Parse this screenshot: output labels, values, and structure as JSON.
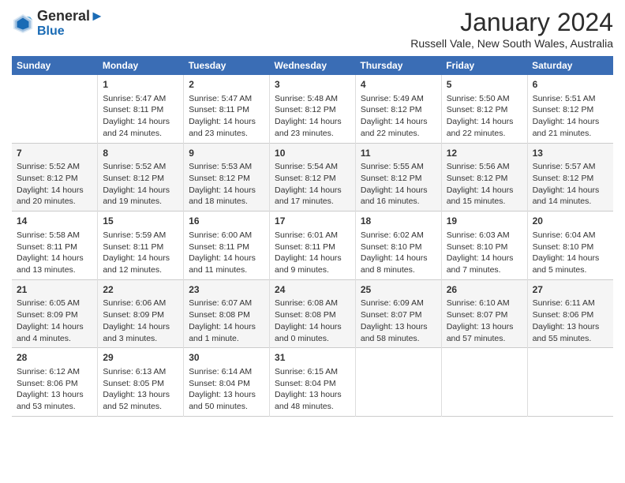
{
  "header": {
    "logo_line1": "General",
    "logo_line2": "Blue",
    "month_year": "January 2024",
    "location": "Russell Vale, New South Wales, Australia"
  },
  "weekdays": [
    "Sunday",
    "Monday",
    "Tuesday",
    "Wednesday",
    "Thursday",
    "Friday",
    "Saturday"
  ],
  "weeks": [
    [
      {
        "day": "",
        "info": ""
      },
      {
        "day": "1",
        "info": "Sunrise: 5:47 AM\nSunset: 8:11 PM\nDaylight: 14 hours\nand 24 minutes."
      },
      {
        "day": "2",
        "info": "Sunrise: 5:47 AM\nSunset: 8:11 PM\nDaylight: 14 hours\nand 23 minutes."
      },
      {
        "day": "3",
        "info": "Sunrise: 5:48 AM\nSunset: 8:12 PM\nDaylight: 14 hours\nand 23 minutes."
      },
      {
        "day": "4",
        "info": "Sunrise: 5:49 AM\nSunset: 8:12 PM\nDaylight: 14 hours\nand 22 minutes."
      },
      {
        "day": "5",
        "info": "Sunrise: 5:50 AM\nSunset: 8:12 PM\nDaylight: 14 hours\nand 22 minutes."
      },
      {
        "day": "6",
        "info": "Sunrise: 5:51 AM\nSunset: 8:12 PM\nDaylight: 14 hours\nand 21 minutes."
      }
    ],
    [
      {
        "day": "7",
        "info": "Sunrise: 5:52 AM\nSunset: 8:12 PM\nDaylight: 14 hours\nand 20 minutes."
      },
      {
        "day": "8",
        "info": "Sunrise: 5:52 AM\nSunset: 8:12 PM\nDaylight: 14 hours\nand 19 minutes."
      },
      {
        "day": "9",
        "info": "Sunrise: 5:53 AM\nSunset: 8:12 PM\nDaylight: 14 hours\nand 18 minutes."
      },
      {
        "day": "10",
        "info": "Sunrise: 5:54 AM\nSunset: 8:12 PM\nDaylight: 14 hours\nand 17 minutes."
      },
      {
        "day": "11",
        "info": "Sunrise: 5:55 AM\nSunset: 8:12 PM\nDaylight: 14 hours\nand 16 minutes."
      },
      {
        "day": "12",
        "info": "Sunrise: 5:56 AM\nSunset: 8:12 PM\nDaylight: 14 hours\nand 15 minutes."
      },
      {
        "day": "13",
        "info": "Sunrise: 5:57 AM\nSunset: 8:12 PM\nDaylight: 14 hours\nand 14 minutes."
      }
    ],
    [
      {
        "day": "14",
        "info": "Sunrise: 5:58 AM\nSunset: 8:11 PM\nDaylight: 14 hours\nand 13 minutes."
      },
      {
        "day": "15",
        "info": "Sunrise: 5:59 AM\nSunset: 8:11 PM\nDaylight: 14 hours\nand 12 minutes."
      },
      {
        "day": "16",
        "info": "Sunrise: 6:00 AM\nSunset: 8:11 PM\nDaylight: 14 hours\nand 11 minutes."
      },
      {
        "day": "17",
        "info": "Sunrise: 6:01 AM\nSunset: 8:11 PM\nDaylight: 14 hours\nand 9 minutes."
      },
      {
        "day": "18",
        "info": "Sunrise: 6:02 AM\nSunset: 8:10 PM\nDaylight: 14 hours\nand 8 minutes."
      },
      {
        "day": "19",
        "info": "Sunrise: 6:03 AM\nSunset: 8:10 PM\nDaylight: 14 hours\nand 7 minutes."
      },
      {
        "day": "20",
        "info": "Sunrise: 6:04 AM\nSunset: 8:10 PM\nDaylight: 14 hours\nand 5 minutes."
      }
    ],
    [
      {
        "day": "21",
        "info": "Sunrise: 6:05 AM\nSunset: 8:09 PM\nDaylight: 14 hours\nand 4 minutes."
      },
      {
        "day": "22",
        "info": "Sunrise: 6:06 AM\nSunset: 8:09 PM\nDaylight: 14 hours\nand 3 minutes."
      },
      {
        "day": "23",
        "info": "Sunrise: 6:07 AM\nSunset: 8:08 PM\nDaylight: 14 hours\nand 1 minute."
      },
      {
        "day": "24",
        "info": "Sunrise: 6:08 AM\nSunset: 8:08 PM\nDaylight: 14 hours\nand 0 minutes."
      },
      {
        "day": "25",
        "info": "Sunrise: 6:09 AM\nSunset: 8:07 PM\nDaylight: 13 hours\nand 58 minutes."
      },
      {
        "day": "26",
        "info": "Sunrise: 6:10 AM\nSunset: 8:07 PM\nDaylight: 13 hours\nand 57 minutes."
      },
      {
        "day": "27",
        "info": "Sunrise: 6:11 AM\nSunset: 8:06 PM\nDaylight: 13 hours\nand 55 minutes."
      }
    ],
    [
      {
        "day": "28",
        "info": "Sunrise: 6:12 AM\nSunset: 8:06 PM\nDaylight: 13 hours\nand 53 minutes."
      },
      {
        "day": "29",
        "info": "Sunrise: 6:13 AM\nSunset: 8:05 PM\nDaylight: 13 hours\nand 52 minutes."
      },
      {
        "day": "30",
        "info": "Sunrise: 6:14 AM\nSunset: 8:04 PM\nDaylight: 13 hours\nand 50 minutes."
      },
      {
        "day": "31",
        "info": "Sunrise: 6:15 AM\nSunset: 8:04 PM\nDaylight: 13 hours\nand 48 minutes."
      },
      {
        "day": "",
        "info": ""
      },
      {
        "day": "",
        "info": ""
      },
      {
        "day": "",
        "info": ""
      }
    ]
  ]
}
